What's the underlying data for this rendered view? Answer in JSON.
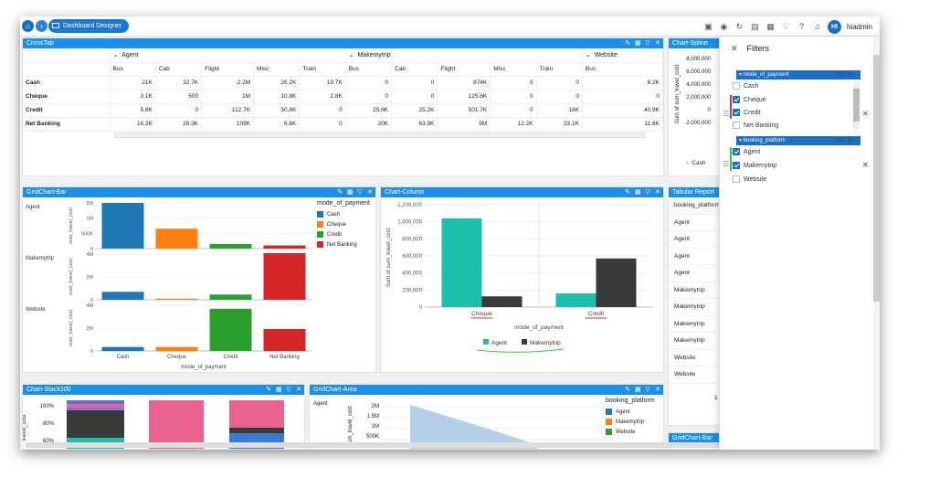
{
  "topbar": {
    "breadcrumb_label": "Dashboard Designer",
    "user_initials": "HI",
    "user_name": "hiadmin"
  },
  "crosstab": {
    "title": "CrossTab",
    "groups": [
      "Agent",
      "Makemytrip",
      "Website"
    ],
    "columns": [
      "Bus",
      "Cab",
      "Flight",
      "Misc",
      "Train",
      "Bus",
      "Cab",
      "Flight",
      "Misc",
      "Train",
      "Bus"
    ],
    "rows": [
      {
        "label": "Cash",
        "values": [
          "21K",
          "32.7K",
          "2.2M",
          "26.2K",
          "19.7K",
          "0",
          "0",
          "874K",
          "0",
          "0",
          "8.2K"
        ]
      },
      {
        "label": "Cheque",
        "values": [
          "3.1K",
          "500",
          "1M",
          "10.8K",
          "2.8K",
          "0",
          "0",
          "125.6K",
          "0",
          "0",
          "0"
        ]
      },
      {
        "label": "Credit",
        "values": [
          "5.8K",
          "0",
          "112.7K",
          "50.8K",
          "0",
          "25.6K",
          "25.2K",
          "501.7K",
          "0",
          "18K",
          "40.9K"
        ]
      },
      {
        "label": "Net Banking",
        "values": [
          "16.3K",
          "28.3K",
          "109K",
          "6.6K",
          "0",
          "20K",
          "63.9K",
          "5M",
          "12.2K",
          "23.1K",
          "11.8K"
        ]
      }
    ]
  },
  "spline": {
    "title": "Chart-Spline",
    "ylabel": "Sum of sum_travel_cost",
    "ticks": [
      "8,000,000",
      "6,000,000",
      "4,000,000",
      "2,000,000",
      "0",
      "-2,000,000"
    ],
    "legend": "Cash"
  },
  "gridbar": {
    "title": "GridChart-Bar",
    "legend_title": "mode_of_payment",
    "legend": [
      "Cash",
      "Cheque",
      "Credit",
      "Net Banking"
    ],
    "colors": [
      "#1f77b4",
      "#ff7f0e",
      "#2ca02c",
      "#d62728"
    ],
    "xlabel": "mode_of_payment",
    "ylabel": "sum_travel_cost",
    "categories": [
      "Cash",
      "Cheque",
      "Credit",
      "Net Banking"
    ],
    "rows": [
      {
        "name": "Agent",
        "ticks": [
          "2M",
          "1M",
          "500K",
          "0"
        ],
        "max": 2300000,
        "values": [
          2300000,
          1000000,
          230000,
          160000
        ]
      },
      {
        "name": "Makemytrip",
        "ticks": [
          "4M",
          "2M",
          "0"
        ],
        "max": 5000000,
        "values": [
          874000,
          125600,
          570000,
          5100000
        ]
      },
      {
        "name": "Website",
        "ticks": [
          "4M",
          "2M",
          "0"
        ],
        "max": 5200000,
        "values": [
          450000,
          450000,
          4800000,
          2500000
        ]
      }
    ]
  },
  "column": {
    "title": "Chart-Column",
    "ylabel": "Sum of sum_travel_cost",
    "xlabel": "mode_of_payment",
    "ticks": [
      "1,200,000",
      "1,000,000",
      "800,000",
      "600,000",
      "400,000",
      "200,000",
      "0"
    ],
    "ymax": 1200000,
    "categories": [
      "Cheque",
      "Credit"
    ],
    "series": [
      {
        "name": "Agent",
        "color": "#1fbfae",
        "values": [
          1040000,
          160000
        ]
      },
      {
        "name": "Makemytrip",
        "color": "#3a3a3a",
        "values": [
          125600,
          570000
        ]
      }
    ]
  },
  "tabular": {
    "title": "Tabular Report",
    "header": "booking_platform",
    "rows": [
      "Agent",
      "Agent",
      "Agent",
      "Agent",
      "Makemytrip",
      "Makemytrip",
      "Makemytrip",
      "Makemytrip",
      "Website",
      "Website"
    ],
    "pager": "1"
  },
  "stack": {
    "title": "Chart-Stack100",
    "ylabel": "travel_cost",
    "ticks": [
      "100%",
      "80%",
      "60%"
    ]
  },
  "area": {
    "title": "GridChart-Area",
    "row": "Agent",
    "ylabel": "sum_travel_cost",
    "ticks": [
      "2M",
      "1.5M",
      "1M",
      "500K"
    ],
    "legend_title": "booking_platform",
    "legend": [
      "Agent",
      "Makemytrip",
      "Website"
    ]
  },
  "gridbar2": {
    "title": "GridChart-Bar"
  },
  "filters": {
    "title": "Filters",
    "groups": [
      {
        "name": "mode_of_payment",
        "all": "ALL",
        "options": [
          {
            "label": "Cash",
            "checked": false
          },
          {
            "label": "Cheque",
            "checked": true
          },
          {
            "label": "Credit",
            "checked": true
          },
          {
            "label": "Net Banking",
            "checked": false
          }
        ]
      },
      {
        "name": "booking_platform",
        "all": "ALL",
        "options": [
          {
            "label": "Agent",
            "checked": true
          },
          {
            "label": "Makemytrip",
            "checked": true
          },
          {
            "label": "Website",
            "checked": false
          }
        ]
      }
    ]
  }
}
